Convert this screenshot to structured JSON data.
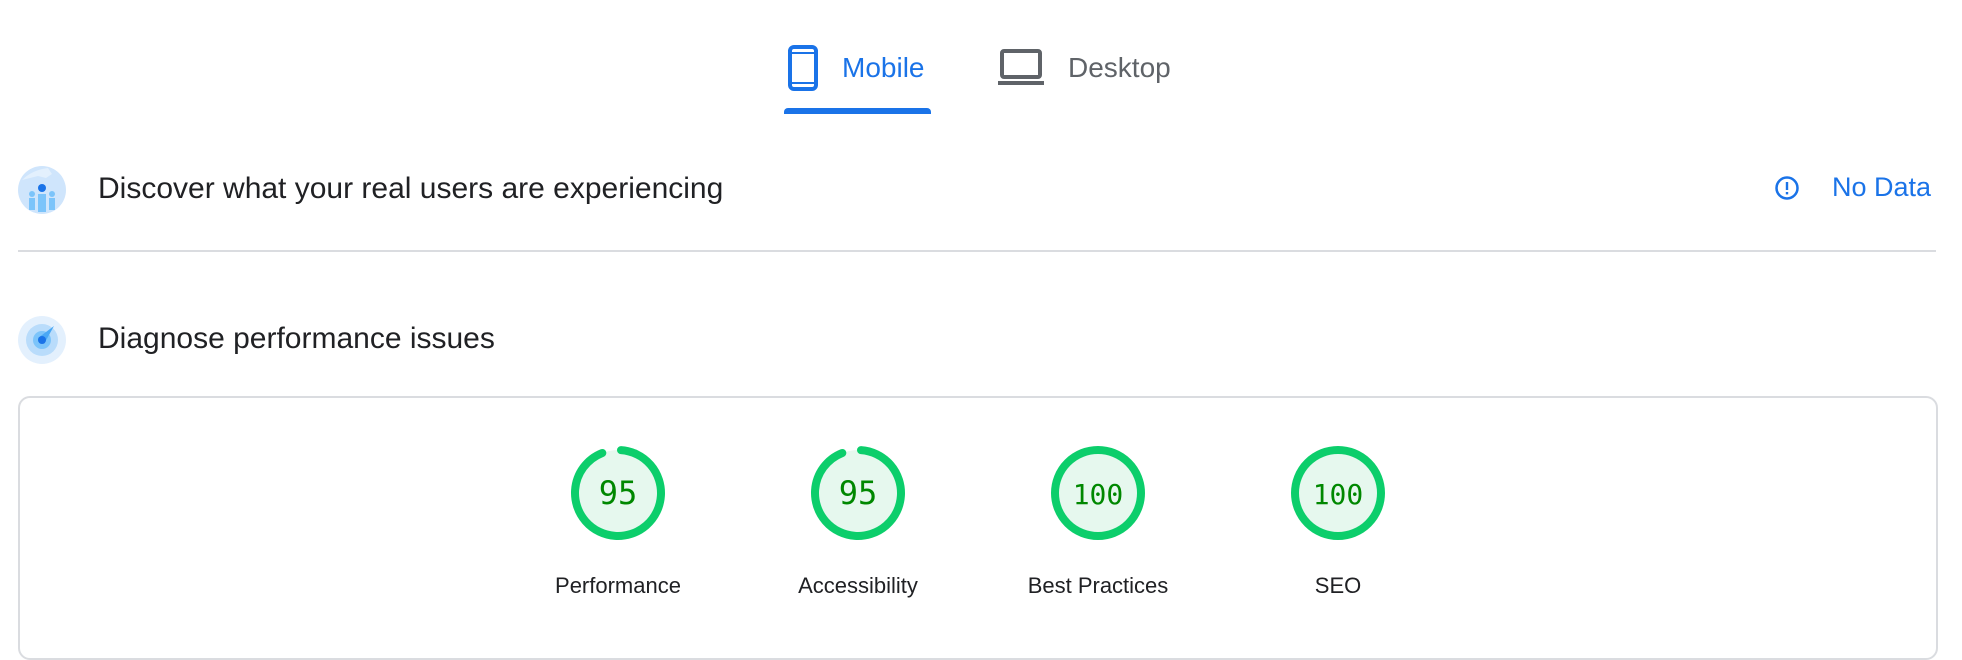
{
  "tabs": [
    {
      "label": "Mobile",
      "icon": "smartphone-icon",
      "active": true
    },
    {
      "label": "Desktop",
      "icon": "laptop-icon",
      "active": false
    }
  ],
  "field_data": {
    "title": "Discover what your real users are experiencing",
    "icon": "users-globe-icon",
    "status_icon": "info-alert-icon",
    "status": "No Data"
  },
  "lab_data": {
    "title": "Diagnose performance issues",
    "icon": "gauge-icon"
  },
  "scores": [
    {
      "label": "Performance",
      "value": "95",
      "score": 95
    },
    {
      "label": "Accessibility",
      "value": "95",
      "score": 95
    },
    {
      "label": "Best Practices",
      "value": "100",
      "score": 100
    },
    {
      "label": "SEO",
      "value": "100",
      "score": 100
    }
  ],
  "colors": {
    "accent": "#1a73e8",
    "pass_ring": "#0cce6b",
    "pass_text": "#008800",
    "pass_fill": "#e6f8ee"
  }
}
